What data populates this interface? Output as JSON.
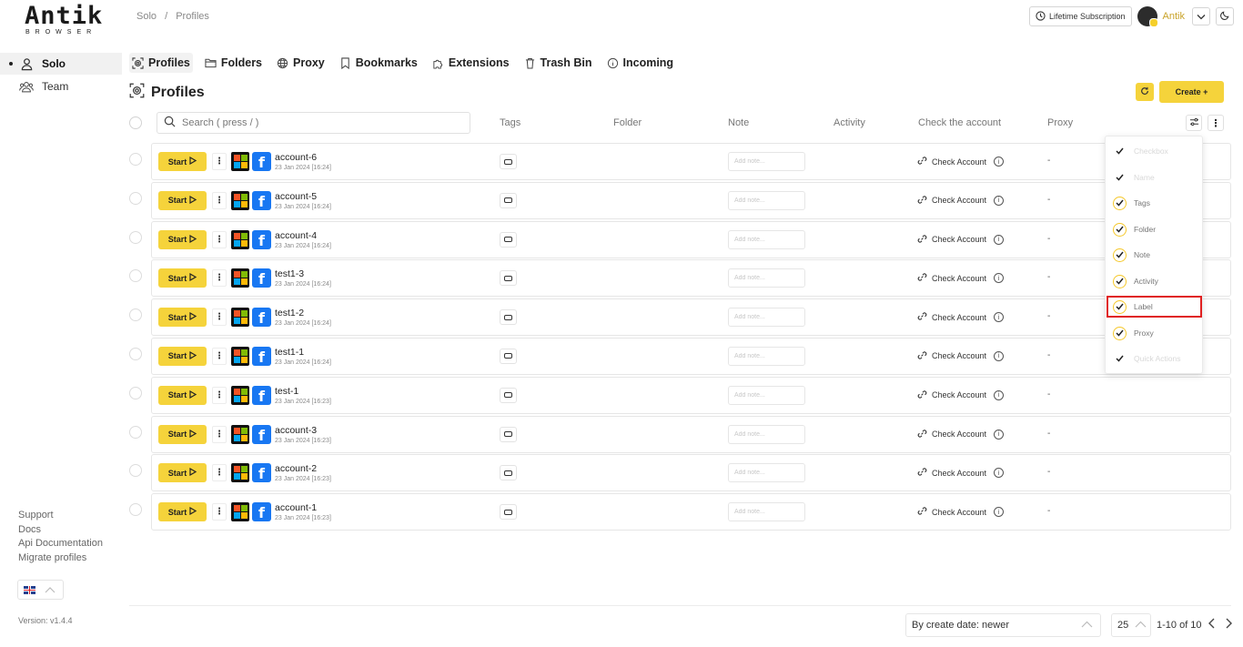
{
  "app": {
    "logo_text": "Antik",
    "logo_subtext": "BROWSER",
    "version": "Version: v1.4.4"
  },
  "sidebar": {
    "items": [
      {
        "label": "Solo",
        "icon": "user-icon",
        "active": true
      },
      {
        "label": "Team",
        "icon": "users-icon",
        "active": false
      }
    ],
    "links": [
      "Support",
      "Docs",
      "Api Documentation",
      "Migrate profiles"
    ],
    "language": "en-flag-icon"
  },
  "header": {
    "breadcrumb": [
      "Solo",
      "/",
      "Profiles"
    ],
    "subscription_label": "Lifetime Subscription",
    "username": "Antik"
  },
  "tabs": [
    {
      "label": "Profiles",
      "icon": "fingerprint-icon",
      "active": true
    },
    {
      "label": "Folders",
      "icon": "folder-icon",
      "active": false
    },
    {
      "label": "Proxy",
      "icon": "globe-icon",
      "active": false
    },
    {
      "label": "Bookmarks",
      "icon": "bookmark-icon",
      "active": false
    },
    {
      "label": "Extensions",
      "icon": "puzzle-icon",
      "active": false
    },
    {
      "label": "Trash Bin",
      "icon": "trash-icon",
      "active": false
    },
    {
      "label": "Incoming",
      "icon": "info-icon",
      "active": false
    }
  ],
  "page": {
    "title": "Profiles",
    "create_label": "Create +"
  },
  "table": {
    "search_placeholder": "Search ( press / )",
    "columns": {
      "tags": "Tags",
      "folder": "Folder",
      "note": "Note",
      "activity": "Activity",
      "check": "Check the account",
      "proxy": "Proxy"
    },
    "start_label": "Start",
    "note_placeholder": "Add note...",
    "check_label": "Check Account",
    "rows": [
      {
        "name": "account-6",
        "date": "23 Jan 2024 [16:24]",
        "proxy": "-"
      },
      {
        "name": "account-5",
        "date": "23 Jan 2024 [16:24]",
        "proxy": "-"
      },
      {
        "name": "account-4",
        "date": "23 Jan 2024 [16:24]",
        "proxy": "-"
      },
      {
        "name": "test1-3",
        "date": "23 Jan 2024 [16:24]",
        "proxy": "-"
      },
      {
        "name": "test1-2",
        "date": "23 Jan 2024 [16:24]",
        "proxy": "-"
      },
      {
        "name": "test1-1",
        "date": "23 Jan 2024 [16:24]",
        "proxy": "-"
      },
      {
        "name": "test-1",
        "date": "23 Jan 2024 [16:23]",
        "proxy": "-"
      },
      {
        "name": "account-3",
        "date": "23 Jan 2024 [16:23]",
        "proxy": "-"
      },
      {
        "name": "account-2",
        "date": "23 Jan 2024 [16:23]",
        "proxy": "-"
      },
      {
        "name": "account-1",
        "date": "23 Jan 2024 [16:23]",
        "proxy": "-"
      }
    ]
  },
  "column_menu": {
    "items": [
      {
        "label": "Checkbox",
        "checked": true,
        "disabled": true
      },
      {
        "label": "Name",
        "checked": true,
        "disabled": true
      },
      {
        "label": "Tags",
        "checked": true,
        "disabled": false
      },
      {
        "label": "Folder",
        "checked": true,
        "disabled": false
      },
      {
        "label": "Note",
        "checked": true,
        "disabled": false
      },
      {
        "label": "Activity",
        "checked": true,
        "disabled": false
      },
      {
        "label": "Label",
        "checked": true,
        "disabled": false
      },
      {
        "label": "Proxy",
        "checked": true,
        "disabled": false
      },
      {
        "label": "Quick Actions",
        "checked": true,
        "disabled": true
      }
    ],
    "highlighted": "Label",
    "highlight_color": "#e02020"
  },
  "footer": {
    "sort_label": "By create date: newer",
    "per_page": "25",
    "page_info": "1-10 of 10"
  },
  "colors": {
    "accent": "#f5d33b",
    "facebook": "#1877f2"
  }
}
